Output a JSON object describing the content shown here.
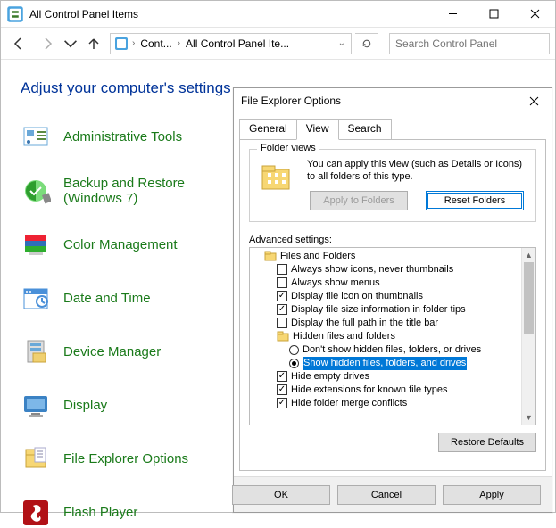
{
  "window": {
    "title": "All Control Panel Items",
    "breadcrumb": [
      "Cont...",
      "All Control Panel Ite..."
    ],
    "search_placeholder": "Search Control Panel"
  },
  "page": {
    "heading": "Adjust your computer's settings",
    "items": [
      "Administrative Tools",
      "Backup and Restore (Windows 7)",
      "Color Management",
      "Date and Time",
      "Device Manager",
      "Display",
      "File Explorer Options",
      "Flash Player"
    ]
  },
  "dialog": {
    "title": "File Explorer Options",
    "tabs": [
      "General",
      "View",
      "Search"
    ],
    "active_tab": "View",
    "folder_views": {
      "legend": "Folder views",
      "text": "You can apply this view (such as Details or Icons) to all folders of this type.",
      "apply_label": "Apply to Folders",
      "reset_label": "Reset Folders"
    },
    "advanced": {
      "label": "Advanced settings:",
      "tree": {
        "root": "Files and Folders",
        "items": [
          {
            "type": "check",
            "checked": false,
            "label": "Always show icons, never thumbnails"
          },
          {
            "type": "check",
            "checked": false,
            "label": "Always show menus"
          },
          {
            "type": "check",
            "checked": true,
            "label": "Display file icon on thumbnails"
          },
          {
            "type": "check",
            "checked": true,
            "label": "Display file size information in folder tips"
          },
          {
            "type": "check",
            "checked": false,
            "label": "Display the full path in the title bar"
          },
          {
            "type": "folder",
            "label": "Hidden files and folders",
            "children": [
              {
                "type": "radio",
                "selected": false,
                "label": "Don't show hidden files, folders, or drives"
              },
              {
                "type": "radio",
                "selected": true,
                "label": "Show hidden files, folders, and drives",
                "highlighted": true
              }
            ]
          },
          {
            "type": "check",
            "checked": true,
            "label": "Hide empty drives"
          },
          {
            "type": "check",
            "checked": true,
            "label": "Hide extensions for known file types"
          },
          {
            "type": "check",
            "checked": true,
            "label": "Hide folder merge conflicts"
          }
        ]
      },
      "restore_label": "Restore Defaults"
    },
    "footer": {
      "ok": "OK",
      "cancel": "Cancel",
      "apply": "Apply"
    }
  }
}
